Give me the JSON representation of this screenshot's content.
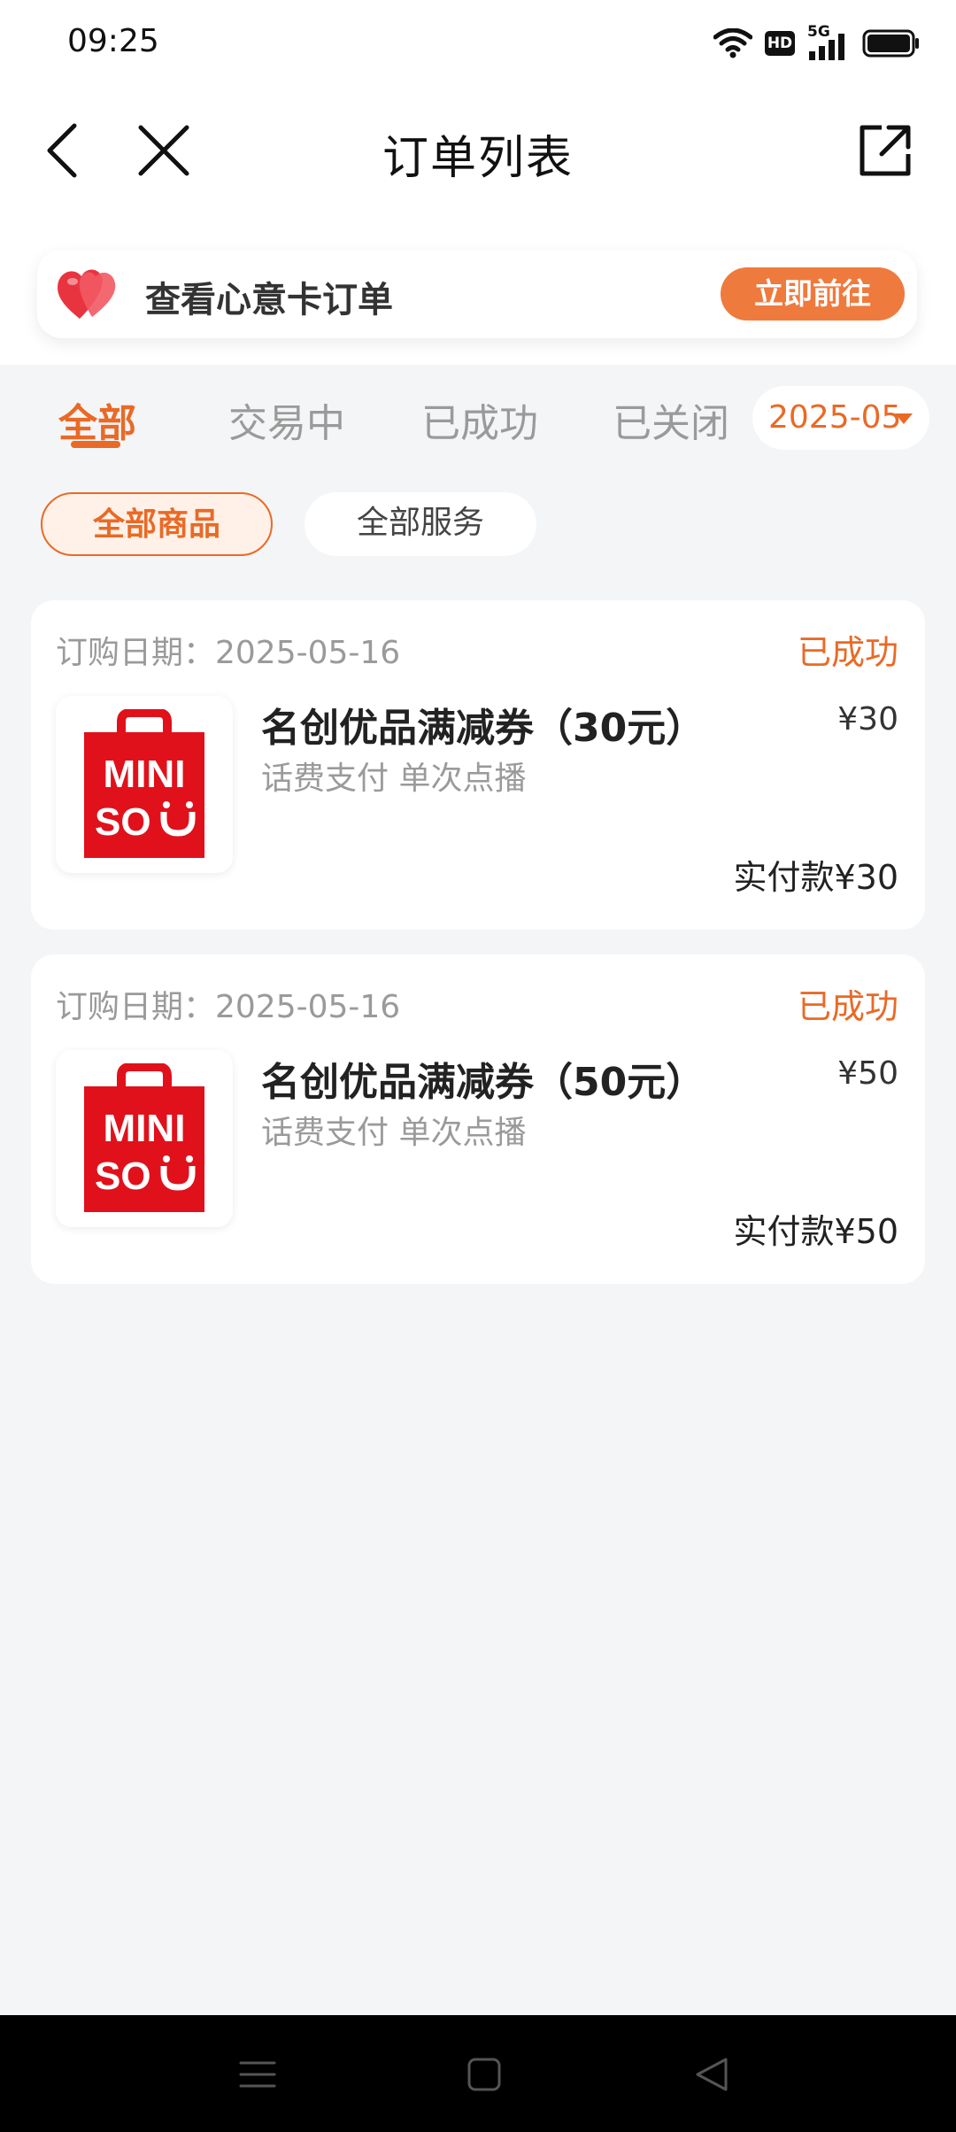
{
  "status_bar": {
    "time": "09:25",
    "icons": [
      "wifi-icon",
      "hd-icon",
      "signal-5g-icon",
      "battery-icon"
    ],
    "hd_label": "HD",
    "network_label": "5G"
  },
  "header": {
    "title": "订单列表",
    "back_icon": "chevron-left-icon",
    "close_icon": "close-icon",
    "share_icon": "share-external-icon"
  },
  "card_banner": {
    "text": "查看心意卡订单",
    "button": "立即前往",
    "icon": "heart-icon"
  },
  "tabs": [
    {
      "label": "全部",
      "active": true
    },
    {
      "label": "交易中",
      "active": false
    },
    {
      "label": "已成功",
      "active": false
    },
    {
      "label": "已关闭",
      "active": false
    }
  ],
  "date_filter": {
    "value": "2025-05",
    "icon": "caret-down-icon"
  },
  "chips": [
    {
      "label": "全部商品",
      "active": true
    },
    {
      "label": "全部服务",
      "active": false
    }
  ],
  "orders": [
    {
      "date": "订购日期：2025-05-16",
      "status": "已成功",
      "title": "名创优品满减券（30元）",
      "subtitle": "话费支付 单次点播",
      "price": "¥30",
      "paid": "实付款¥30",
      "logo_text": [
        "MINI",
        "SO"
      ]
    },
    {
      "date": "订购日期：2025-05-16",
      "status": "已成功",
      "title": "名创优品满减券（50元）",
      "subtitle": "话费支付 单次点播",
      "price": "¥50",
      "paid": "实付款¥50",
      "logo_text": [
        "MINI",
        "SO"
      ]
    }
  ],
  "system_nav": {
    "icons": [
      "menu-icon",
      "home-icon",
      "back-triangle-icon"
    ]
  },
  "colors": {
    "accent": "#e96a26",
    "button": "#ef7a3d",
    "background": "#f4f5f7",
    "brand_red": "#e0111b"
  }
}
